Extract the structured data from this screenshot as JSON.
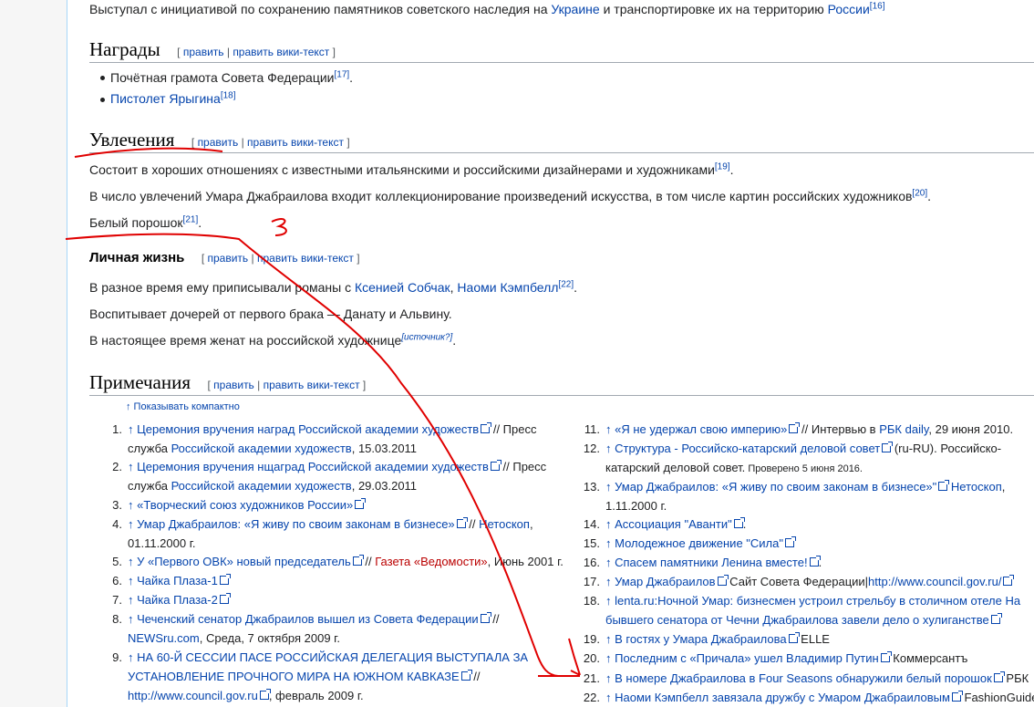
{
  "intro": {
    "text_a": "Выступал с инициативой по сохранению памятников советского наследия на ",
    "link_ukraine": "Украине",
    "text_b": " и транспортировке их на территорию ",
    "link_russia": "России",
    "ref": "[16]"
  },
  "awards": {
    "title": "Награды",
    "edit": "править",
    "edit_wiki": "править вики-текст",
    "items": [
      {
        "text": "Почётная грамота Совета Федерации",
        "ref": "[17]",
        "suffix": "."
      },
      {
        "link": "Пистолет Ярыгина",
        "ref": "[18]"
      }
    ]
  },
  "hobbies": {
    "title": "Увлечения",
    "edit": "править",
    "edit_wiki": "править вики-текст",
    "p1": "Состоит в хороших отношениях с известными итальянскими и российскими дизайнерами и художниками",
    "p1_ref": "[19]",
    "p2": "В число увлечений Умара Джабраилова входит коллекционирование произведений искусства, в том числе картин российских художников",
    "p2_ref": "[20]",
    "p3": "Белый порошок",
    "p3_ref": "[21]"
  },
  "personal": {
    "title": "Личная жизнь",
    "edit": "править",
    "edit_wiki": "править вики-текст",
    "p1_text": "В разное время ему приписывали романы с ",
    "p1_link1": "Ксенией Собчак",
    "p1_link2": "Наоми Кэмпбелл",
    "p1_ref": "[22]",
    "p2": "Воспитывает дочерей от первого брака — Данату и Альвину.",
    "p3": "В настоящее время женат на российской художнице",
    "p3_ref": "[источник?]"
  },
  "notes": {
    "title": "Примечания",
    "edit": "править",
    "edit_wiki": "править вики-текст",
    "compact": "↑ Показывать компактно",
    "left": [
      {
        "n": "1.",
        "l1_link": "↑ Церемония вручения наград Российской академии художеств",
        "l1_tail": " // Пресс",
        "l2_text": "служба ",
        "l2_link": "Российской академии художеств",
        "l2_tail": ", 15.03.2011"
      },
      {
        "n": "2.",
        "l1_link": "↑ Церемония вручения нщаград Российской академии художеств",
        "l1_tail": " // Пресс",
        "l2_text": "служба ",
        "l2_link": "Российской академии художеств",
        "l2_tail": ", 29.03.2011"
      },
      {
        "n": "3.",
        "l1_link": "↑ «Творческий союз художников России»"
      },
      {
        "n": "4.",
        "l1_link": "↑ Умар Джабраилов: «Я живу по своим законам в бизнесе»",
        "l1_tail": " // ",
        "l1_link2": "Нетоскоп",
        "l1_tail2": ",",
        "l2_text": "01.11.2000 г."
      },
      {
        "n": "5.",
        "l1_link": "↑ У «Первого ОВК» новый председатель",
        "l1_tail": " // ",
        "l1_red": "Газета «Ведомости»",
        "l1_tail2": ", Июнь 2001 г."
      },
      {
        "n": "6.",
        "l1_link": "↑ Чайка Плаза-1"
      },
      {
        "n": "7.",
        "l1_link": "↑ Чайка Плаза-2"
      },
      {
        "n": "8.",
        "l1_link": "↑ Чеченский сенатор Джабраилов вышел из Совета Федерации",
        "l1_tail": " //",
        "l2_link": "NEWSru.com",
        "l2_tail": ", Среда, 7 октября 2009 г."
      },
      {
        "n": "9.",
        "l1_link": "↑ НА 60-Й СЕССИИ ПАСЕ РОССИЙСКАЯ ДЕЛЕГАЦИЯ ВЫСТУПАЛА ЗА",
        "l2_link": "УСТАНОВЛЕНИЕ ПРОЧНОГО МИРА НА ЮЖНОМ КАВКАЗЕ",
        "l2_tail": " //",
        "l3_link": "http://www.council.gov.ru",
        "l3_tail": ", февраль 2009 г."
      }
    ],
    "right": [
      {
        "n": "11.",
        "l1_link": "↑ «Я не удержал свою империю»",
        "l1_tail": " // Интервью в ",
        "l1_link2": "РБК daily",
        "l1_tail2": ", 29 июня 2010."
      },
      {
        "n": "12.",
        "l1_link": "↑ Структура - Российско-катарский деловой совет",
        "l1_tail": " (ru-RU). Российско-",
        "l2_text": "катарский деловой совет.",
        "l2_small": " Проверено 5 июня 2016."
      },
      {
        "n": "13.",
        "l1_link": "↑ Умар Джабраилов: «Я живу по своим законам в бизнесе»\"",
        "l1_tail": " ",
        "l1_link2": "Нетоскоп",
        "l1_tail2": ",",
        "l2_text": "1.11.2000 г."
      },
      {
        "n": "14.",
        "l1_link": "↑ Ассоциация \"Аванти\"",
        "l1_tail": "."
      },
      {
        "n": "15.",
        "l1_link": "↑ Молодежное движение \"Сила\""
      },
      {
        "n": "16.",
        "l1_link": "↑ Спасем памятники Ленина вместе!",
        "l1_tail": "."
      },
      {
        "n": "17.",
        "l1_link": "↑ Умар Джабраилов",
        "l1_tail": " Сайт Совета Федерации|",
        "l1_link2": "http://www.council.gov.ru/"
      },
      {
        "n": "18.",
        "l1_link": "↑ lenta.ru:Ночной Умар: бизнесмен устроил стрельбу в столичном отеле На",
        "l2_link": "бывшего сенатора от Чечни Джабраилова завели дело о хулиганстве"
      },
      {
        "n": "19.",
        "l1_link": "↑ В гостях у Умара Джабраилова",
        "l1_tail": " ELLE"
      },
      {
        "n": "20.",
        "l1_link": "↑ Последним с «Причала» ушел Владимир Путин",
        "l1_tail": " Коммерсантъ"
      },
      {
        "n": "21.",
        "l1_link": "↑ В номере Джабраилова в Four Seasons обнаружили белый порошок",
        "l1_tail": " РБК"
      },
      {
        "n": "22.",
        "l1_link": "↑ Наоми Кэмпбелл завязала дружбу с Умаром Джабраиловым",
        "l1_tail": " FashionGuide,"
      }
    ]
  },
  "colors": {
    "link": "#0645ad",
    "red_link": "#ba0000",
    "ink": "#e00000",
    "highlight": "#eaf3ff"
  }
}
